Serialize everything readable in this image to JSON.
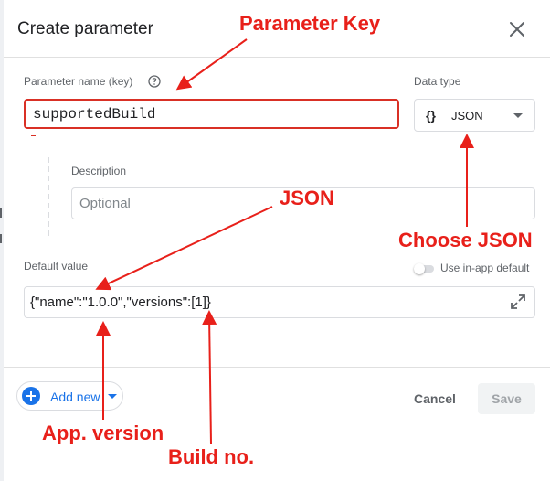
{
  "dialog": {
    "title": "Create parameter",
    "close_icon": "close-icon"
  },
  "parameter": {
    "name_label": "Parameter name (key)",
    "help_icon": "help-circle-icon",
    "name_value": "supportedBuild",
    "data_type_label": "Data type",
    "data_type_icon": "{}",
    "data_type_value": "JSON",
    "description_label": "Description",
    "description_placeholder": "Optional",
    "default_value_label": "Default value",
    "use_inapp_default_label": "Use in-app default",
    "use_inapp_default_on": false,
    "default_value": "{\"name\":\"1.0.0\",\"versions\":[1]}",
    "expand_icon": "expand-icon"
  },
  "footer": {
    "add_new_label": "Add new",
    "cancel_label": "Cancel",
    "save_label": "Save"
  },
  "annotations": {
    "parameter_key": "Parameter Key",
    "json": "JSON",
    "choose_json": "Choose JSON",
    "app_version": "App. version",
    "build_no": "Build no."
  },
  "colors": {
    "annotation": "#e8201a",
    "error_border": "#d93025",
    "accent": "#1a73e8"
  }
}
